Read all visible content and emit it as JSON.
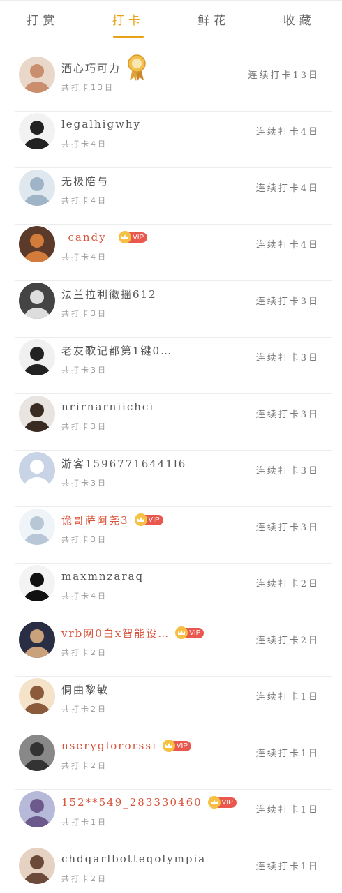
{
  "tabs": [
    "打赏",
    "打卡",
    "鲜花",
    "收藏"
  ],
  "active_tab": 1,
  "colors": {
    "accent": "#e8a21a",
    "vip_name": "#d9533a",
    "vip_tag": "#e8584f"
  },
  "rows": [
    {
      "name": "酒心巧可力",
      "sub": "共打卡13日",
      "streak": "连续打卡13日",
      "vip": false,
      "medal": true
    },
    {
      "name": "legalhigwhy",
      "sub": "共打卡4日",
      "streak": "连续打卡4日",
      "vip": false
    },
    {
      "name": "无极陪与",
      "sub": "共打卡4日",
      "streak": "连续打卡4日",
      "vip": false
    },
    {
      "name": "_candy_",
      "sub": "共打卡4日",
      "streak": "连续打卡4日",
      "vip": true,
      "vip_label": "VIP"
    },
    {
      "name": "法兰拉利徽摇612",
      "sub": "共打卡3日",
      "streak": "连续打卡3日",
      "vip": false
    },
    {
      "name": "老友歌记都第1键0…",
      "sub": "共打卡3日",
      "streak": "连续打卡3日",
      "vip": false
    },
    {
      "name": "nrirnarniichci",
      "sub": "共打卡3日",
      "streak": "连续打卡3日",
      "vip": false
    },
    {
      "name": "游客15967716441l6",
      "sub": "共打卡3日",
      "streak": "连续打卡3日",
      "vip": false
    },
    {
      "name": "诡哥萨阿尧3",
      "sub": "共打卡3日",
      "streak": "连续打卡3日",
      "vip": true,
      "vip_label": "VIP"
    },
    {
      "name": "maxmnzaraq",
      "sub": "共打卡4日",
      "streak": "连续打卡2日",
      "vip": false
    },
    {
      "name": "vrb网0白x智能设…",
      "sub": "共打卡2日",
      "streak": "连续打卡2日",
      "vip": true,
      "vip_label": "VIP"
    },
    {
      "name": "侗曲黎敏",
      "sub": "共打卡2日",
      "streak": "连续打卡1日",
      "vip": false
    },
    {
      "name": "nseryglororssi",
      "sub": "共打卡2日",
      "streak": "连续打卡1日",
      "vip": true,
      "vip_label": "VIP"
    },
    {
      "name": "152**549_283330460",
      "sub": "共打卡1日",
      "streak": "连续打卡1日",
      "vip": true,
      "vip_label": "VIP"
    },
    {
      "name": "chdqarlbotteqolympia",
      "sub": "共打卡2日",
      "streak": "连续打卡1日",
      "vip": false
    }
  ]
}
